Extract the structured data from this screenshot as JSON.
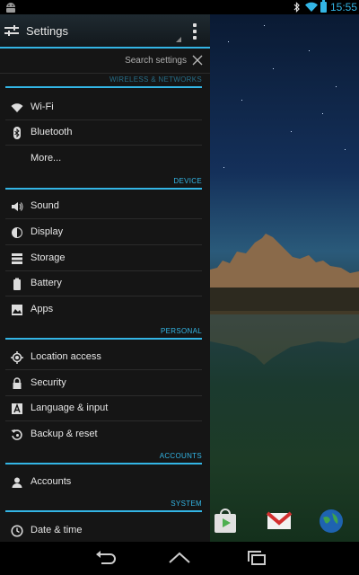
{
  "status_bar": {
    "time": "15:55"
  },
  "header": {
    "title": "Settings"
  },
  "search": {
    "hint": "Search settings"
  },
  "sections": {
    "wireless": "WIRELESS & NETWORKS",
    "device": "DEVICE",
    "personal": "PERSONAL",
    "accounts": "ACCOUNTS",
    "system": "SYSTEM"
  },
  "items": {
    "wifi": "Wi-Fi",
    "bluetooth": "Bluetooth",
    "more": "More...",
    "sound": "Sound",
    "display": "Display",
    "storage": "Storage",
    "battery": "Battery",
    "apps": "Apps",
    "location": "Location access",
    "security": "Security",
    "language": "Language & input",
    "backup": "Backup & reset",
    "accounts": "Accounts",
    "datetime": "Date & time"
  },
  "colors": {
    "accent": "#33b5e5",
    "panel": "#151515"
  },
  "icons": [
    "android-icon",
    "bluetooth-icon",
    "wifi-icon",
    "battery-icon",
    "sliders-icon",
    "overflow-menu-icon",
    "close-icon",
    "play-store-icon",
    "gmail-icon",
    "browser-globe-icon",
    "back-icon",
    "home-icon",
    "recents-icon"
  ]
}
